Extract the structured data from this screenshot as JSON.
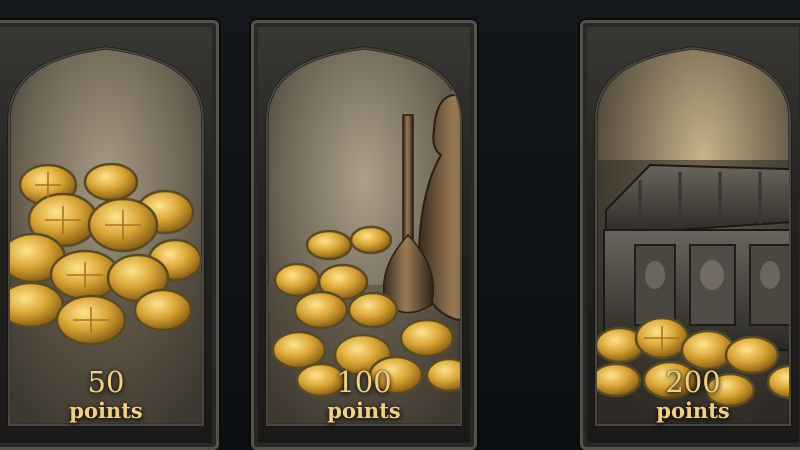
{
  "packs": [
    {
      "amount": "50",
      "unit": "points",
      "art": "coin-pile"
    },
    {
      "amount": "100",
      "unit": "points",
      "art": "coins-and-jeweled-vessels"
    },
    {
      "amount": "200",
      "unit": "points",
      "art": "treasure-chest-with-coins"
    }
  ],
  "colors": {
    "gold": "#d9a536",
    "text": "#f0cf86",
    "frame": "#2a2825",
    "background": "#101418"
  }
}
